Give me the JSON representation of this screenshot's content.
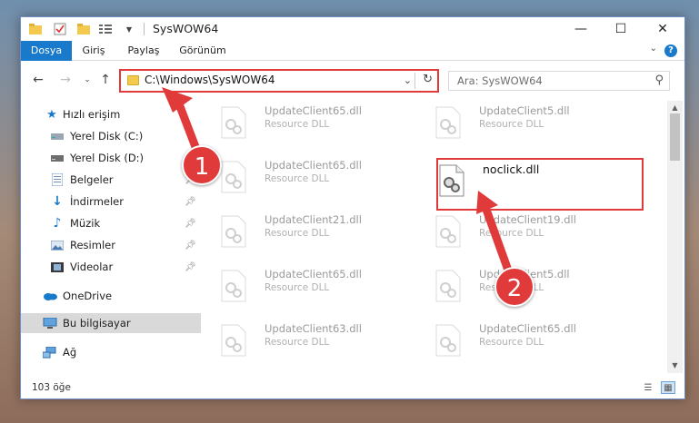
{
  "window": {
    "title": "SysWOW64",
    "minimize_glyph": "—",
    "maximize_glyph": "☐",
    "close_glyph": "✕"
  },
  "ribbon": {
    "tabs": [
      {
        "label": "Dosya",
        "active": true
      },
      {
        "label": "Giriş"
      },
      {
        "label": "Paylaş"
      },
      {
        "label": "Görünüm"
      }
    ],
    "help": "?"
  },
  "address": {
    "path": "C:\\Windows\\SysWOW64",
    "search_placeholder": "Ara: SysWOW64"
  },
  "sidebar": {
    "items": [
      {
        "label": "Hızlı erişim",
        "icon": "star-icon"
      },
      {
        "label": "Yerel Disk (C:)",
        "icon": "drive-icon"
      },
      {
        "label": "Yerel Disk (D:)",
        "icon": "drive-icon"
      },
      {
        "label": "Belgeler",
        "icon": "documents-icon",
        "pinned": true
      },
      {
        "label": "İndirmeler",
        "icon": "download-icon",
        "pinned": true
      },
      {
        "label": "Müzik",
        "icon": "music-icon",
        "pinned": true
      },
      {
        "label": "Resimler",
        "icon": "pictures-icon",
        "pinned": true
      },
      {
        "label": "Videolar",
        "icon": "videos-icon",
        "pinned": true
      },
      {
        "label": "OneDrive",
        "icon": "cloud-icon"
      },
      {
        "label": "Bu bilgisayar",
        "icon": "computer-icon",
        "selected": true
      },
      {
        "label": "Ağ",
        "icon": "network-icon"
      }
    ]
  },
  "files": [
    {
      "name": "UpdateClient65.dll",
      "type": "Resource DLL"
    },
    {
      "name": "UpdateClient5.dll",
      "type": "Resource DLL"
    },
    {
      "name": "UpdateClient65.dll",
      "type": "Resource DLL"
    },
    {
      "name": "noclick.dll",
      "type": ""
    },
    {
      "name": "UpdateClient21.dll",
      "type": "Resource DLL"
    },
    {
      "name": "UpdateClient19.dll",
      "type": "Resource DLL"
    },
    {
      "name": "UpdateClient65.dll",
      "type": "Resource DLL"
    },
    {
      "name": "UpdateClient5.dll",
      "type": "Resource DLL"
    },
    {
      "name": "UpdateClient63.dll",
      "type": "Resource DLL"
    },
    {
      "name": "UpdateClient65.dll",
      "type": "Resource DLL"
    }
  ],
  "status": {
    "item_count": "103 öğe"
  },
  "annotations": {
    "step1": "1",
    "step2": "2",
    "color": "#e03a3a"
  }
}
